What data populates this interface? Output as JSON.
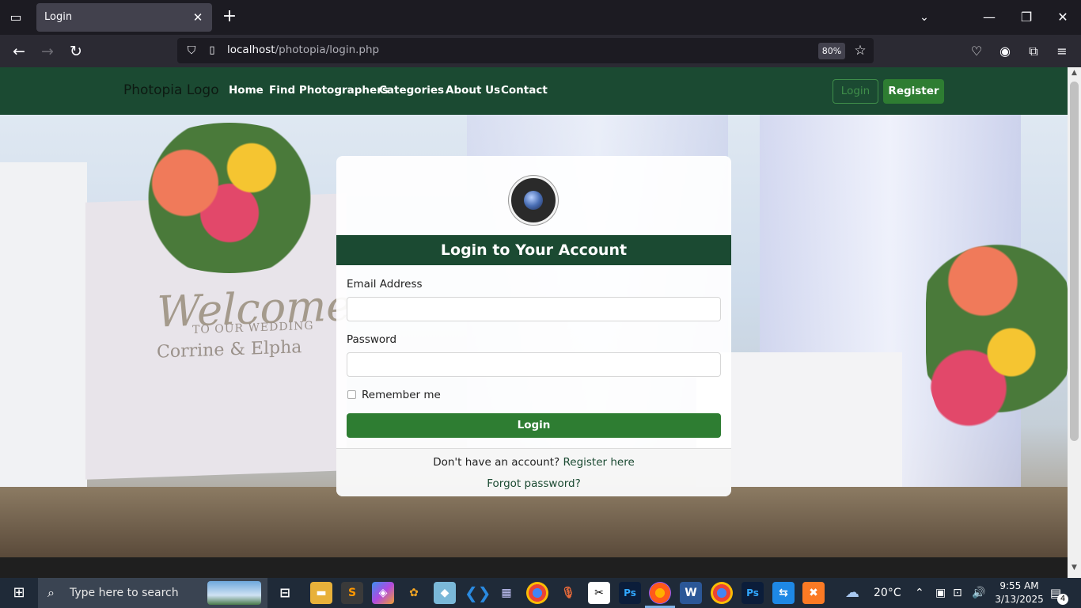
{
  "browser": {
    "tab_title": "Login",
    "url_host": "localhost",
    "url_path": "/photopia/login.php",
    "zoom": "80%"
  },
  "site": {
    "brand": "Photopia Logo",
    "nav": [
      "Home",
      "Find Photographers",
      "Categories",
      "About Us",
      "Contact"
    ],
    "login_btn": "Login",
    "register_btn": "Register"
  },
  "hero": {
    "sign_line1": "Welcome",
    "sign_line2": "TO OUR WEDDING",
    "sign_line3": "Corrine & Elpha"
  },
  "login_card": {
    "title": "Login to Your Account",
    "email_label": "Email Address",
    "email_value": "",
    "password_label": "Password",
    "password_value": "",
    "remember_label": "Remember me",
    "remember_checked": false,
    "submit_label": "Login",
    "no_account_text": "Don't have an account?",
    "register_link": "Register here",
    "forgot_link": "Forgot password?"
  },
  "taskbar": {
    "search_placeholder": "Type here to search",
    "weather": "20°C",
    "time": "9:55 AM",
    "date": "3/13/2025",
    "notifications": "4"
  },
  "colors": {
    "brand_green": "#1b4a32",
    "button_green": "#2e7d32",
    "browser_dark": "#1c1b22"
  }
}
